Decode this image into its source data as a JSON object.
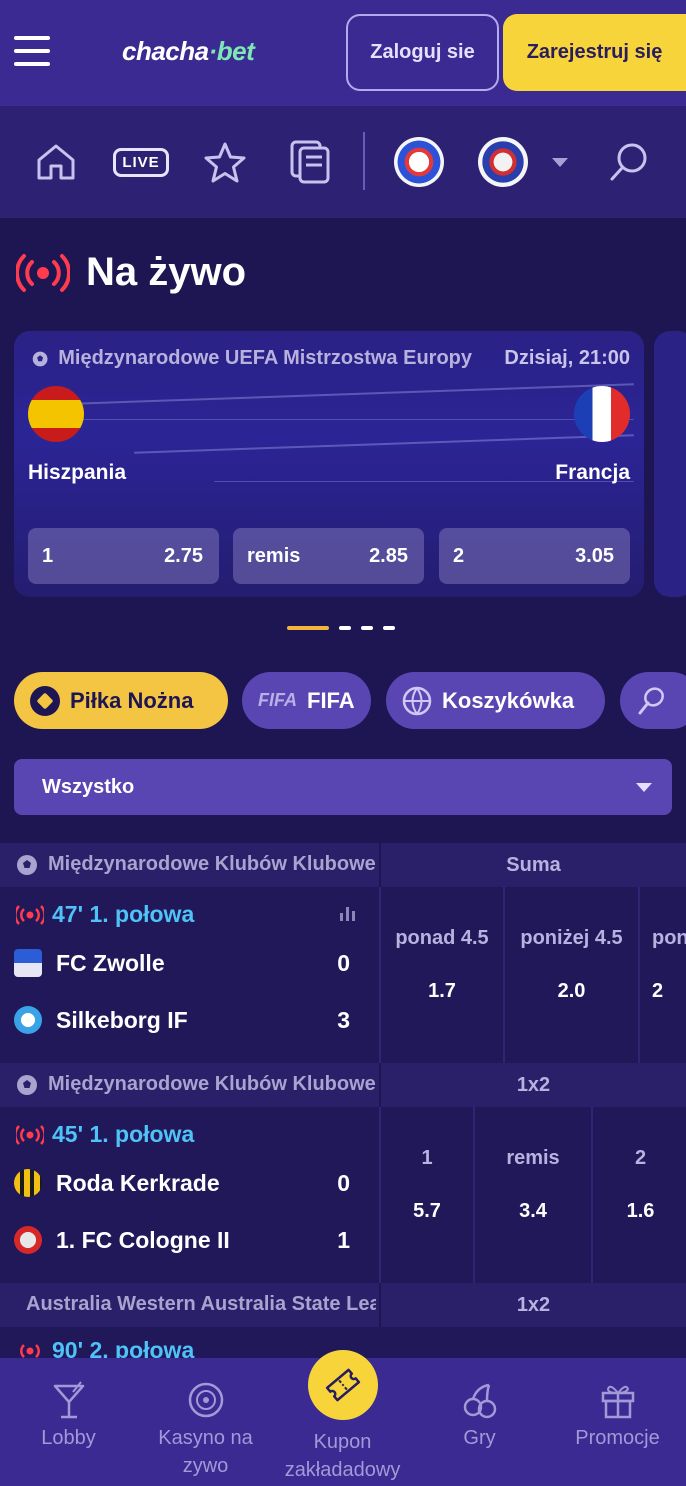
{
  "header": {
    "logo_main": "chacha",
    "logo_dot": "·",
    "logo_suffix": "bet",
    "login_label": "Zaloguj sie",
    "register_label": "Zarejestruj się"
  },
  "nav": {
    "live_label": "LIVE"
  },
  "live_section": {
    "title": "Na żywo"
  },
  "featured": {
    "league": "Międzynarodowe UEFA Mistrzostwa Europy",
    "time": "Dzisiaj, 21:00",
    "home": "Hiszpania",
    "away": "Francja",
    "odds": [
      {
        "label": "1",
        "value": "2.75"
      },
      {
        "label": "remis",
        "value": "2.85"
      },
      {
        "label": "2",
        "value": "3.05"
      }
    ]
  },
  "sports": [
    {
      "label": "Piłka Nożna"
    },
    {
      "label": "FIFA",
      "badge": "FIFA"
    },
    {
      "label": "Koszykówka"
    }
  ],
  "filter": {
    "selected": "Wszystko"
  },
  "matches": [
    {
      "league": "Międzynarodowe Klubów Klubowe",
      "market": "Suma",
      "status": "47' 1. połowa",
      "home": {
        "name": "FC Zwolle",
        "score": "0"
      },
      "away": {
        "name": "Silkeborg IF",
        "score": "3"
      },
      "odds": [
        {
          "label": "ponad 4.5",
          "value": "1.7"
        },
        {
          "label": "poniżej 4.5",
          "value": "2.0"
        },
        {
          "label": "pon",
          "value": "2"
        }
      ]
    },
    {
      "league": "Międzynarodowe Klubów Klubowe",
      "market": "1x2",
      "status": "45' 1. połowa",
      "home": {
        "name": "Roda Kerkrade",
        "score": "0"
      },
      "away": {
        "name": "1. FC Cologne II",
        "score": "1"
      },
      "odds": [
        {
          "label": "1",
          "value": "5.7"
        },
        {
          "label": "remis",
          "value": "3.4"
        },
        {
          "label": "2",
          "value": "1.6"
        }
      ]
    },
    {
      "league": "Australia Western Australia State League",
      "market": "1x2",
      "status": "90' 2. połowa"
    }
  ],
  "bottom_nav": [
    {
      "label": "Lobby",
      "icon": "cocktail-icon"
    },
    {
      "label": "Kasyno na zywo",
      "icon": "roulette-icon"
    },
    {
      "label": "Kupon zakładadowy",
      "icon": "ticket-icon"
    },
    {
      "label": "Gry",
      "icon": "cherries-icon"
    },
    {
      "label": "Promocje",
      "icon": "gift-icon"
    }
  ],
  "colors": {
    "accent_yellow": "#f7d53a",
    "header_purple": "#3a2a91",
    "live_red": "#ff3b4e",
    "live_blue": "#4fc3f7"
  }
}
